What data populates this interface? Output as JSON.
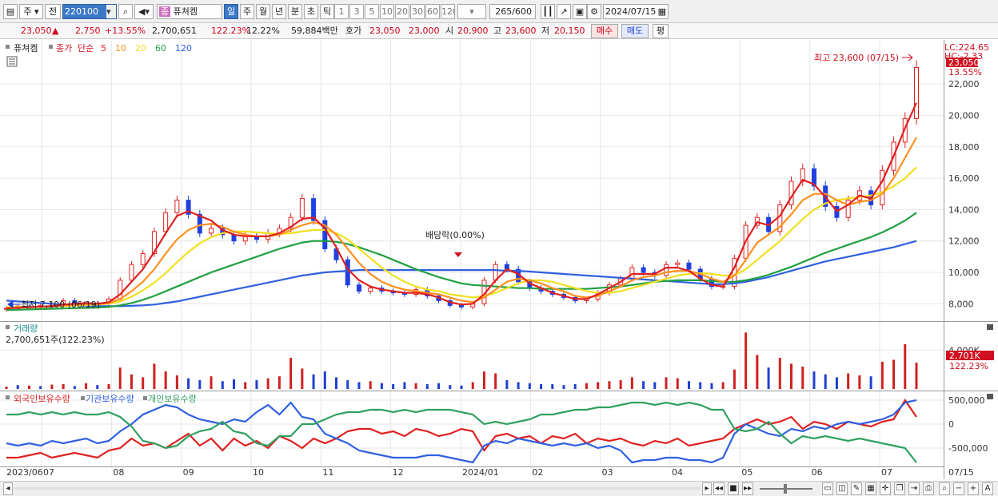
{
  "toolbar": {
    "market_label": "주",
    "prev_label": "전",
    "code": "220100",
    "stock_type_badge": "종",
    "stock_name": "퓨쳐켐",
    "periods": [
      "일",
      "주",
      "월",
      "년",
      "분",
      "초",
      "틱"
    ],
    "period_selected": "일",
    "intervals": [
      "1",
      "3",
      "5",
      "10",
      "20",
      "30",
      "60",
      "120"
    ],
    "count_current": "265",
    "count_total": "/600",
    "date": "2024/07/15"
  },
  "infobar": {
    "price": "23,050",
    "change_arrow": "▲",
    "change": "2,750",
    "change_pct": "+13.55%",
    "volume": "2,700,651",
    "volume_ratio": "122.23%",
    "turnover": "12.22%",
    "amount": "59,884백만",
    "quote_label": "호가",
    "ask": "23,050",
    "bid": "23,000",
    "open_label": "시",
    "open": "20,900",
    "high_label": "고",
    "high": "23,600",
    "low_label": "저",
    "low": "20,150",
    "buy_label": "매수",
    "sell_label": "매도",
    "avg_label": "평"
  },
  "chart_data": {
    "type": "candlestick",
    "dates_axis": [
      "2023/06",
      "07",
      "08",
      "09",
      "10",
      "11",
      "12",
      "2024/01",
      "02",
      "03",
      "04",
      "05",
      "06",
      "07",
      "07/15"
    ],
    "price_panel": {
      "legend_stock": "퓨쳐켐",
      "legend_close": "종가",
      "legend_ma_type": "단순",
      "ma_periods": [
        "5",
        "10",
        "20",
        "60",
        "120"
      ],
      "ma_colors": [
        "#e02020",
        "#ff9020",
        "#f0e020",
        "#20a040",
        "#3060e0"
      ],
      "yticks": [
        "22,000",
        "20,000",
        "18,000",
        "16,000",
        "14,000",
        "12,000",
        "10,000",
        "8,000"
      ],
      "ylim": [
        7000,
        24600
      ],
      "lc_label": "LC:224.65",
      "hc_label": "HC:-2.33",
      "last_price_tag": "23,050",
      "last_pct_tag": "13.55%",
      "high_annotation": "최고 23,600 (07/15)",
      "high_value": 23600,
      "low_annotation": "최저 7,100 (06/19)",
      "low_value": 7100,
      "dividend_annotation": "배당락(0.00%)",
      "close_series": [
        7700,
        7850,
        7800,
        7900,
        8000,
        8200,
        7950,
        7900,
        8000,
        8300,
        9500,
        10500,
        11200,
        12600,
        13800,
        14600,
        13700,
        12500,
        12800,
        12400,
        12000,
        12300,
        12100,
        12500,
        12800,
        13500,
        14700,
        13300,
        11500,
        10800,
        9200,
        8800,
        9000,
        8800,
        8700,
        8600,
        8900,
        8500,
        8200,
        7900,
        7800,
        8000,
        9500,
        10500,
        10200,
        9400,
        9000,
        8800,
        8600,
        8400,
        8200,
        8300,
        8700,
        9200,
        9600,
        10300,
        10000,
        9800,
        10500,
        10600,
        10200,
        9600,
        9100,
        9100,
        10900,
        13000,
        13500,
        12600,
        14300,
        15800,
        16600,
        15500,
        14200,
        13500,
        14600,
        15200,
        14300,
        16500,
        18300,
        19800,
        23050
      ],
      "ma5_series": [
        7700,
        7750,
        7780,
        7820,
        7850,
        7950,
        8000,
        8050,
        8000,
        8100,
        8600,
        9400,
        10200,
        11300,
        12500,
        13600,
        13900,
        13600,
        13300,
        12700,
        12400,
        12300,
        12300,
        12300,
        12500,
        12900,
        13400,
        13500,
        12800,
        11600,
        10200,
        9500,
        9100,
        8900,
        8800,
        8700,
        8700,
        8600,
        8400,
        8100,
        7950,
        8000,
        8600,
        9500,
        10200,
        9900,
        9300,
        9000,
        8700,
        8500,
        8300,
        8300,
        8600,
        9000,
        9400,
        9900,
        9900,
        9900,
        10300,
        10300,
        10100,
        9600,
        9200,
        9100,
        10300,
        12000,
        13200,
        13000,
        13600,
        14800,
        15900,
        15600,
        14800,
        13900,
        14300,
        14900,
        14700,
        15800,
        17400,
        19200,
        20800
      ],
      "ma10_series": [
        7750,
        7760,
        7780,
        7800,
        7820,
        7880,
        7930,
        7960,
        7980,
        8050,
        8300,
        8800,
        9400,
        10200,
        11200,
        12100,
        12700,
        13000,
        13100,
        12900,
        12600,
        12400,
        12300,
        12300,
        12400,
        12700,
        13000,
        13200,
        13000,
        12400,
        11500,
        10600,
        9900,
        9400,
        9100,
        8900,
        8800,
        8700,
        8600,
        8400,
        8200,
        8100,
        8400,
        8900,
        9400,
        9600,
        9500,
        9300,
        9000,
        8800,
        8500,
        8400,
        8500,
        8800,
        9100,
        9500,
        9700,
        9800,
        10000,
        10100,
        10100,
        9900,
        9600,
        9400,
        9800,
        10800,
        11900,
        12400,
        12900,
        13700,
        14600,
        15000,
        15000,
        14600,
        14300,
        14500,
        14600,
        15000,
        16000,
        17300,
        18600
      ],
      "ma20_series": [
        7800,
        7800,
        7800,
        7810,
        7830,
        7860,
        7890,
        7920,
        7950,
        8000,
        8150,
        8450,
        8850,
        9350,
        9950,
        10650,
        11300,
        11850,
        12250,
        12500,
        12600,
        12600,
        12550,
        12500,
        12450,
        12500,
        12600,
        12700,
        12700,
        12500,
        12100,
        11500,
        10900,
        10300,
        9800,
        9400,
        9100,
        8900,
        8800,
        8600,
        8500,
        8400,
        8500,
        8700,
        9000,
        9300,
        9500,
        9500,
        9400,
        9200,
        9000,
        8800,
        8700,
        8700,
        8800,
        9000,
        9200,
        9400,
        9600,
        9800,
        9900,
        9950,
        9900,
        9800,
        9800,
        10200,
        10800,
        11400,
        12000,
        12700,
        13400,
        14000,
        14400,
        14600,
        14700,
        14800,
        14900,
        15100,
        15500,
        16000,
        16700
      ],
      "ma60_series": [
        7600,
        7620,
        7640,
        7660,
        7680,
        7700,
        7720,
        7740,
        7760,
        7800,
        7900,
        8050,
        8250,
        8500,
        8800,
        9100,
        9400,
        9700,
        10000,
        10250,
        10500,
        10750,
        11000,
        11250,
        11500,
        11700,
        11900,
        12000,
        12000,
        11950,
        11800,
        11600,
        11350,
        11100,
        10800,
        10500,
        10200,
        9950,
        9700,
        9500,
        9300,
        9200,
        9150,
        9100,
        9050,
        9000,
        9000,
        8950,
        8950,
        8950,
        8950,
        8950,
        9000,
        9050,
        9100,
        9200,
        9300,
        9400,
        9450,
        9500,
        9500,
        9500,
        9450,
        9400,
        9400,
        9500,
        9650,
        9850,
        10100,
        10350,
        10650,
        10950,
        11250,
        11500,
        11750,
        12000,
        12250,
        12550,
        12900,
        13300,
        13800
      ],
      "ma120_series": [
        8200,
        8150,
        8100,
        8050,
        8000,
        7950,
        7900,
        7880,
        7860,
        7850,
        7850,
        7870,
        7900,
        7950,
        8050,
        8150,
        8300,
        8450,
        8600,
        8750,
        8900,
        9050,
        9200,
        9350,
        9500,
        9650,
        9800,
        9900,
        10000,
        10050,
        10100,
        10150,
        10150,
        10150,
        10150,
        10150,
        10150,
        10150,
        10150,
        10150,
        10150,
        10150,
        10150,
        10150,
        10100,
        10100,
        10050,
        10000,
        9950,
        9900,
        9850,
        9800,
        9750,
        9700,
        9650,
        9600,
        9550,
        9500,
        9450,
        9400,
        9350,
        9300,
        9250,
        9250,
        9300,
        9400,
        9550,
        9700,
        9900,
        10100,
        10300,
        10500,
        10700,
        10850,
        11000,
        11150,
        11300,
        11450,
        11600,
        11800,
        12000
      ]
    },
    "volume_panel": {
      "title": "거래량",
      "value_label": "2,700,651주(122.23%)",
      "ytick": "4,000K",
      "last_tag": "2,701K",
      "last_pct_tag": "122.23%",
      "ylim": [
        0,
        5500
      ],
      "values": [
        250,
        400,
        350,
        300,
        450,
        500,
        300,
        600,
        400,
        500,
        2200,
        1500,
        1200,
        2600,
        1800,
        1400,
        1100,
        900,
        1300,
        800,
        1000,
        700,
        900,
        1100,
        1300,
        3200,
        2100,
        1500,
        1800,
        1200,
        900,
        700,
        800,
        600,
        500,
        700,
        600,
        500,
        600,
        400,
        350,
        700,
        1800,
        1600,
        900,
        700,
        600,
        500,
        500,
        400,
        500,
        600,
        700,
        800,
        900,
        1200,
        800,
        700,
        1200,
        1100,
        800,
        700,
        600,
        700,
        2000,
        5800,
        3500,
        2200,
        3200,
        2600,
        2300,
        1800,
        1500,
        1200,
        1600,
        1400,
        1300,
        2800,
        3000,
        4600,
        2701
      ],
      "colors": [
        "r",
        "b",
        "r",
        "b",
        "r",
        "r",
        "b",
        "r",
        "b",
        "r",
        "r",
        "r",
        "r",
        "r",
        "r",
        "r",
        "b",
        "b",
        "r",
        "b",
        "b",
        "r",
        "b",
        "r",
        "r",
        "r",
        "r",
        "b",
        "b",
        "b",
        "b",
        "b",
        "r",
        "b",
        "b",
        "b",
        "r",
        "b",
        "b",
        "b",
        "b",
        "r",
        "r",
        "r",
        "b",
        "b",
        "b",
        "b",
        "b",
        "b",
        "b",
        "r",
        "r",
        "r",
        "r",
        "r",
        "b",
        "b",
        "r",
        "r",
        "b",
        "b",
        "b",
        "r",
        "r",
        "r",
        "r",
        "b",
        "r",
        "r",
        "r",
        "b",
        "b",
        "b",
        "r",
        "r",
        "b",
        "r",
        "r",
        "r",
        "r"
      ]
    },
    "holding_panel": {
      "legend": [
        "외국인보유수량",
        "기관보유수량",
        "개인보유수량"
      ],
      "colors": [
        "#e02020",
        "#3060e0",
        "#30a060"
      ],
      "yticks": [
        "500,000",
        "0",
        "-500,000"
      ],
      "ylim": [
        -850000,
        650000
      ],
      "foreign": [
        -700000,
        -700000,
        -650000,
        -600000,
        -700000,
        -650000,
        -600000,
        -650000,
        -700000,
        -550000,
        -500000,
        -300000,
        -450000,
        -400000,
        -500000,
        -350000,
        -200000,
        -450000,
        -300000,
        -550000,
        -300000,
        -450000,
        -350000,
        -500000,
        -250000,
        -350000,
        -500000,
        -300000,
        -400000,
        -300000,
        -150000,
        -100000,
        -100000,
        -200000,
        -150000,
        -250000,
        -100000,
        -150000,
        -250000,
        -200000,
        -100000,
        -150000,
        -550000,
        -250000,
        -200000,
        -300000,
        -250000,
        -400000,
        -250000,
        -300000,
        -200000,
        -400000,
        -300000,
        -350000,
        -300000,
        -400000,
        -450000,
        -350000,
        -400000,
        -300000,
        -450000,
        -400000,
        -350000,
        -300000,
        -100000,
        0,
        100000,
        0,
        50000,
        150000,
        -100000,
        50000,
        0,
        -100000,
        50000,
        0,
        -50000,
        50000,
        100000,
        500000,
        150000
      ],
      "institution": [
        -400000,
        -450000,
        -400000,
        -450000,
        -350000,
        -400000,
        -350000,
        -300000,
        -400000,
        -350000,
        -150000,
        0,
        200000,
        300000,
        400000,
        350000,
        200000,
        100000,
        50000,
        0,
        100000,
        50000,
        250000,
        400000,
        200000,
        450000,
        150000,
        100000,
        -200000,
        -300000,
        -400000,
        -550000,
        -600000,
        -650000,
        -700000,
        -700000,
        -700000,
        -650000,
        -650000,
        -700000,
        -750000,
        -800000,
        -450000,
        -350000,
        -400000,
        -300000,
        -350000,
        -400000,
        -450000,
        -400000,
        -450000,
        -400000,
        -500000,
        -450000,
        -550000,
        -800000,
        -750000,
        -750000,
        -700000,
        -700000,
        -750000,
        -750000,
        -800000,
        -700000,
        -200000,
        0,
        -100000,
        -200000,
        -250000,
        -100000,
        -150000,
        -50000,
        -100000,
        0,
        50000,
        0,
        50000,
        100000,
        200000,
        450000,
        500000
      ],
      "individual": [
        200000,
        200000,
        250000,
        200000,
        250000,
        200000,
        250000,
        200000,
        200000,
        250000,
        150000,
        -50000,
        -350000,
        -400000,
        -500000,
        -450000,
        -250000,
        -150000,
        -100000,
        50000,
        -150000,
        -200000,
        -400000,
        -450000,
        -250000,
        -250000,
        0,
        0,
        100000,
        200000,
        250000,
        250000,
        300000,
        300000,
        250000,
        300000,
        250000,
        300000,
        300000,
        300000,
        250000,
        200000,
        0,
        50000,
        0,
        50000,
        100000,
        200000,
        200000,
        250000,
        300000,
        300000,
        350000,
        350000,
        400000,
        450000,
        450000,
        400000,
        450000,
        400000,
        450000,
        400000,
        300000,
        300000,
        -100000,
        -150000,
        -100000,
        50000,
        -200000,
        -400000,
        -250000,
        -300000,
        -250000,
        -300000,
        -350000,
        -300000,
        -350000,
        -400000,
        -450000,
        -500000,
        -800000
      ]
    }
  }
}
